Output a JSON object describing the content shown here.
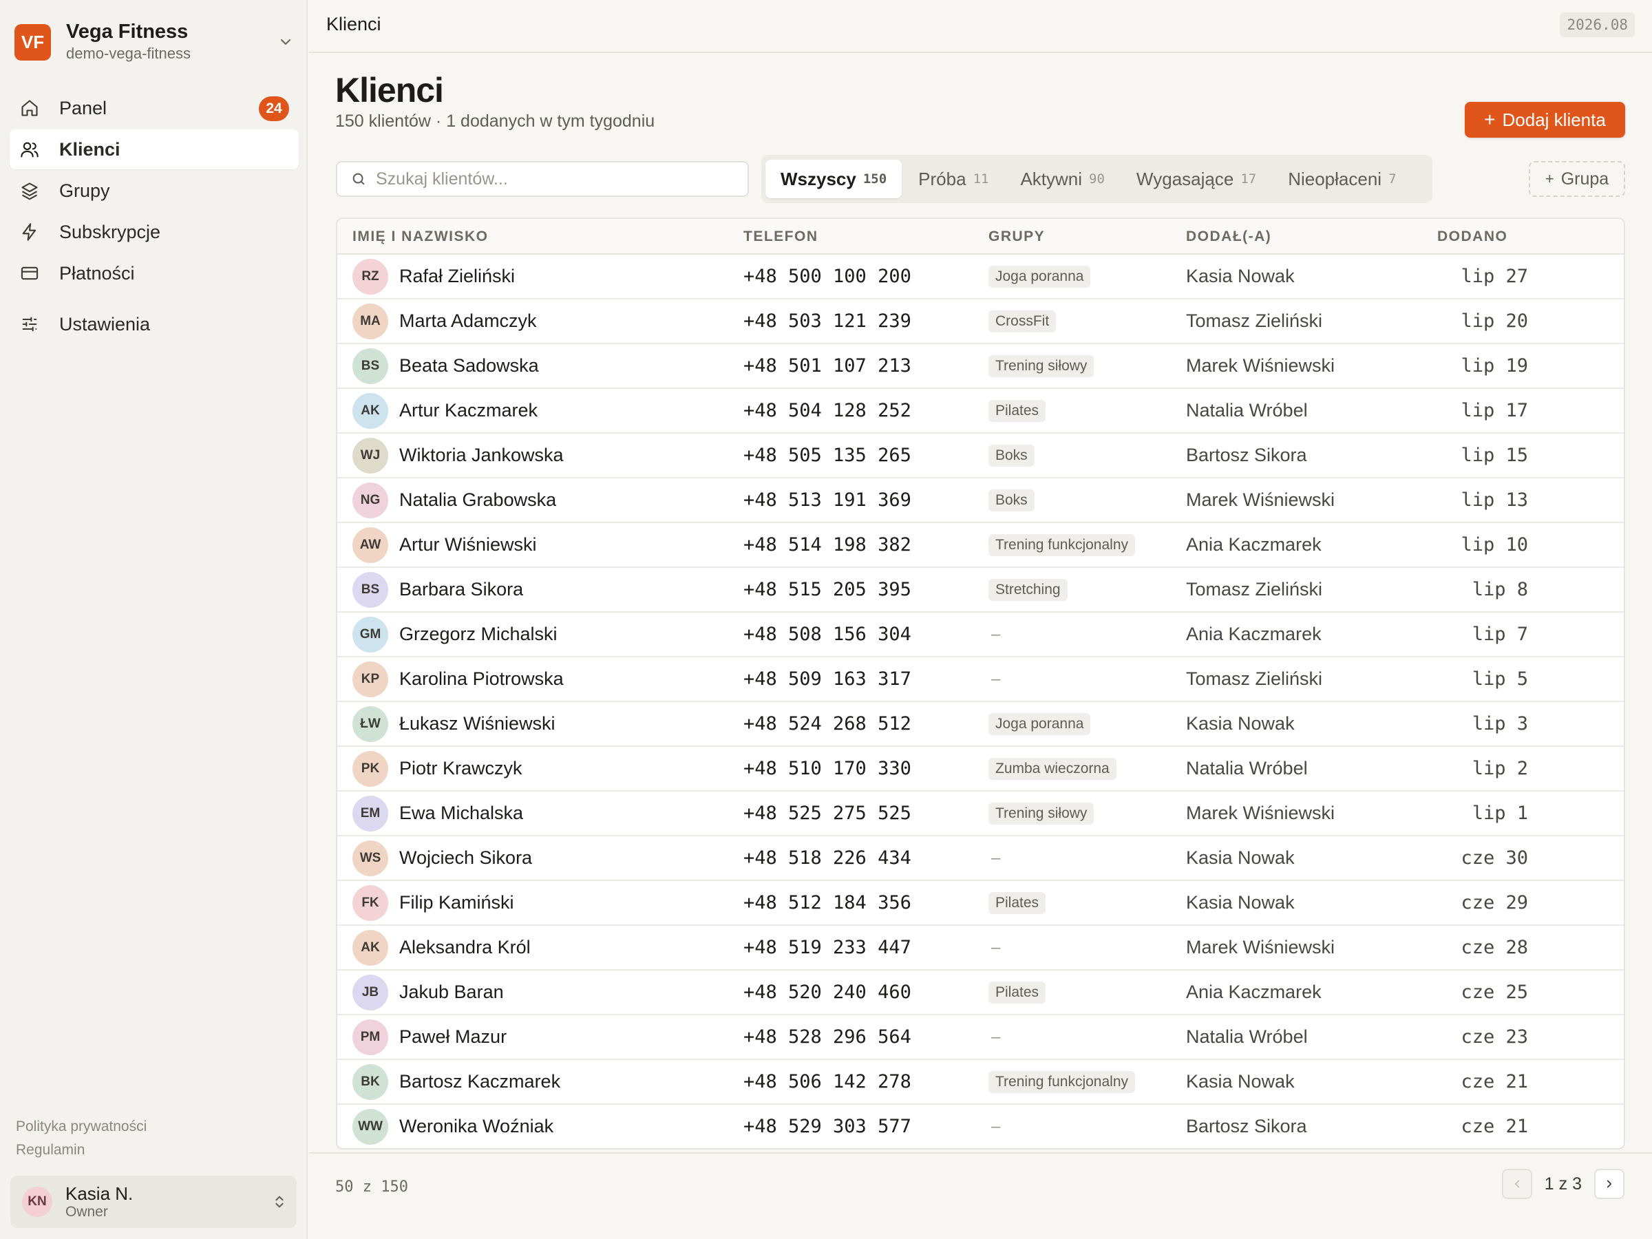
{
  "workspace": {
    "logo": "VF",
    "name": "Vega Fitness",
    "slug": "demo-vega-fitness"
  },
  "nav": {
    "panel": {
      "label": "Panel",
      "badge": "24",
      "icon": "home-icon"
    },
    "clients": {
      "label": "Klienci",
      "icon": "users-icon"
    },
    "groups": {
      "label": "Grupy",
      "icon": "layers-icon"
    },
    "subscriptions": {
      "label": "Subskrypcje",
      "icon": "bolt-icon"
    },
    "payments": {
      "label": "Płatności",
      "icon": "card-icon"
    },
    "settings": {
      "label": "Ustawienia",
      "icon": "sliders-icon"
    }
  },
  "legal": {
    "privacy": "Polityka prywatności",
    "terms": "Regulamin"
  },
  "user": {
    "initials": "KN",
    "name": "Kasia N.",
    "role": "Owner"
  },
  "topbar": {
    "breadcrumb": "Klienci",
    "version": "2026.08"
  },
  "page": {
    "title": "Klienci",
    "subtitle": "150 klientów · 1 dodanych w tym tygodniu",
    "add_button": "Dodaj klienta",
    "search_placeholder": "Szukaj klientów...",
    "group_button": "Grupa"
  },
  "tabs": [
    {
      "label": "Wszyscy",
      "count": "150"
    },
    {
      "label": "Próba",
      "count": "11"
    },
    {
      "label": "Aktywni",
      "count": "90"
    },
    {
      "label": "Wygasające",
      "count": "17"
    },
    {
      "label": "Nieopłaceni",
      "count": "7"
    }
  ],
  "table": {
    "headers": {
      "name": "IMIĘ I NAZWISKO",
      "phone": "TELEFON",
      "groups": "GRUPY",
      "added_by": "DODAŁ(-A)",
      "added": "DODANO"
    },
    "rows": [
      {
        "initials": "RZ",
        "name": "Rafał Zieliński",
        "phone": "+48 500 100 200",
        "group": "Joga poranna",
        "by": "Kasia Nowak",
        "date": "lip 27",
        "color": "#f3d3d6"
      },
      {
        "initials": "MA",
        "name": "Marta Adamczyk",
        "phone": "+48 503 121 239",
        "group": "CrossFit",
        "by": "Tomasz Zieliński",
        "date": "lip 20",
        "color": "#f1d5c4"
      },
      {
        "initials": "BS",
        "name": "Beata Sadowska",
        "phone": "+48 501 107 213",
        "group": "Trening siłowy",
        "by": "Marek Wiśniewski",
        "date": "lip 19",
        "color": "#cfe2d3"
      },
      {
        "initials": "AK",
        "name": "Artur Kaczmarek",
        "phone": "+48 504 128 252",
        "group": "Pilates",
        "by": "Natalia Wróbel",
        "date": "lip 17",
        "color": "#cde3ee"
      },
      {
        "initials": "WJ",
        "name": "Wiktoria Jankowska",
        "phone": "+48 505 135 265",
        "group": "Boks",
        "by": "Bartosz Sikora",
        "date": "lip 15",
        "color": "#dedbcb"
      },
      {
        "initials": "NG",
        "name": "Natalia Grabowska",
        "phone": "+48 513 191 369",
        "group": "Boks",
        "by": "Marek Wiśniewski",
        "date": "lip 13",
        "color": "#f0d2dd"
      },
      {
        "initials": "AW",
        "name": "Artur Wiśniewski",
        "phone": "+48 514 198 382",
        "group": "Trening funkcjonalny",
        "by": "Ania Kaczmarek",
        "date": "lip 10",
        "color": "#f1d5c4"
      },
      {
        "initials": "BS",
        "name": "Barbara Sikora",
        "phone": "+48 515 205 395",
        "group": "Stretching",
        "by": "Tomasz Zieliński",
        "date": "lip 8",
        "color": "#dcd8f0"
      },
      {
        "initials": "GM",
        "name": "Grzegorz Michalski",
        "phone": "+48 508 156 304",
        "group": "",
        "by": "Ania Kaczmarek",
        "date": "lip 7",
        "color": "#cde3ee"
      },
      {
        "initials": "KP",
        "name": "Karolina Piotrowska",
        "phone": "+48 509 163 317",
        "group": "",
        "by": "Tomasz Zieliński",
        "date": "lip 5",
        "color": "#f1d5c4"
      },
      {
        "initials": "ŁW",
        "name": "Łukasz Wiśniewski",
        "phone": "+48 524 268 512",
        "group": "Joga poranna",
        "by": "Kasia Nowak",
        "date": "lip 3",
        "color": "#cfe2d3"
      },
      {
        "initials": "PK",
        "name": "Piotr Krawczyk",
        "phone": "+48 510 170 330",
        "group": "Zumba wieczorna",
        "by": "Natalia Wróbel",
        "date": "lip 2",
        "color": "#f1d5c4"
      },
      {
        "initials": "EM",
        "name": "Ewa Michalska",
        "phone": "+48 525 275 525",
        "group": "Trening siłowy",
        "by": "Marek Wiśniewski",
        "date": "lip 1",
        "color": "#dcd8f0"
      },
      {
        "initials": "WS",
        "name": "Wojciech Sikora",
        "phone": "+48 518 226 434",
        "group": "",
        "by": "Kasia Nowak",
        "date": "cze 30",
        "color": "#f1d5c4"
      },
      {
        "initials": "FK",
        "name": "Filip Kamiński",
        "phone": "+48 512 184 356",
        "group": "Pilates",
        "by": "Kasia Nowak",
        "date": "cze 29",
        "color": "#f3d3d6"
      },
      {
        "initials": "AK",
        "name": "Aleksandra Król",
        "phone": "+48 519 233 447",
        "group": "",
        "by": "Marek Wiśniewski",
        "date": "cze 28",
        "color": "#f1d5c4"
      },
      {
        "initials": "JB",
        "name": "Jakub Baran",
        "phone": "+48 520 240 460",
        "group": "Pilates",
        "by": "Ania Kaczmarek",
        "date": "cze 25",
        "color": "#dcd8f0"
      },
      {
        "initials": "PM",
        "name": "Paweł Mazur",
        "phone": "+48 528 296 564",
        "group": "",
        "by": "Natalia Wróbel",
        "date": "cze 23",
        "color": "#f0d2dd"
      },
      {
        "initials": "BK",
        "name": "Bartosz Kaczmarek",
        "phone": "+48 506 142 278",
        "group": "Trening funkcjonalny",
        "by": "Kasia Nowak",
        "date": "cze 21",
        "color": "#cfe2d3"
      },
      {
        "initials": "WW",
        "name": "Weronika Woźniak",
        "phone": "+48 529 303 577",
        "group": "",
        "by": "Bartosz Sikora",
        "date": "cze 21",
        "color": "#cfe2d3"
      }
    ]
  },
  "footer": {
    "count": "50 z 150",
    "page": "1",
    "of": "z",
    "total": "3"
  }
}
